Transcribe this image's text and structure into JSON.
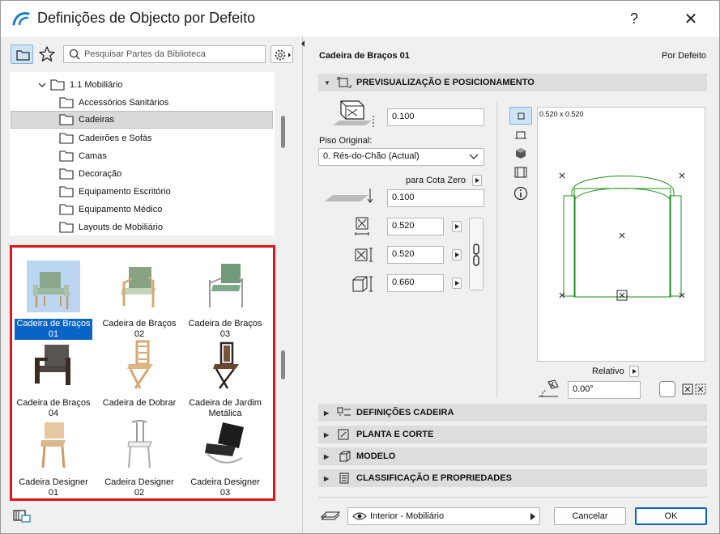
{
  "window": {
    "title": "Definições de Objecto por Defeito",
    "help_label": "?",
    "close_label": "✕"
  },
  "library": {
    "search_placeholder": "Pesquisar Partes da Biblioteca",
    "tree": [
      {
        "label": "1.1 Mobiliário"
      },
      {
        "label": "Accessórios Sanitários"
      },
      {
        "label": "Cadeiras"
      },
      {
        "label": "Cadeirões e Sofás"
      },
      {
        "label": "Camas"
      },
      {
        "label": "Decoração"
      },
      {
        "label": "Equipamento Escritório"
      },
      {
        "label": "Equipamento Médico"
      },
      {
        "label": "Layouts de Mobiliário"
      }
    ],
    "thumbnails": [
      {
        "line1": "Cadeira de Braços",
        "line2": "01"
      },
      {
        "line1": "Cadeira de Braços",
        "line2": "02"
      },
      {
        "line1": "Cadeira de Braços",
        "line2": "03"
      },
      {
        "line1": "Cadeira de Braços",
        "line2": "04"
      },
      {
        "line1": "Cadeira de Dobrar",
        "line2": ""
      },
      {
        "line1": "Cadeira de Jardim",
        "line2": "Metálica"
      },
      {
        "line1": "Cadeira Designer",
        "line2": "01"
      },
      {
        "line1": "Cadeira Designer",
        "line2": "02"
      },
      {
        "line1": "Cadeira Designer",
        "line2": "03"
      }
    ]
  },
  "settings": {
    "object_name": "Cadeira de Braços 01",
    "default_label": "Por Defeito",
    "preview_section": "PREVISUALIZAÇÃO E POSICIONAMENTO",
    "offset_value": "0.100",
    "floor_label": "Piso Original:",
    "floor_value": "0. Rés-do-Chão (Actual)",
    "cota_label": "para Cota Zero",
    "cota_value": "0.100",
    "width_value": "0.520",
    "depth_value": "0.520",
    "height_value": "0.660",
    "preview_size": "0.520 x 0.520",
    "relative_label": "Relativo",
    "angle_value": "0.00°",
    "sections": [
      {
        "label": "DEFINIÇÕES CADEIRA"
      },
      {
        "label": "PLANTA E CORTE"
      },
      {
        "label": "MODELO"
      },
      {
        "label": "CLASSIFICAÇÃO E PROPRIEDADES"
      }
    ],
    "layer_value": "Interior - Mobiliário",
    "cancel_label": "Cancelar",
    "ok_label": "OK"
  },
  "colors": {
    "accent": "#0a64c8",
    "highlight_border": "#e0141b",
    "plan_green": "#1e8c1e"
  }
}
